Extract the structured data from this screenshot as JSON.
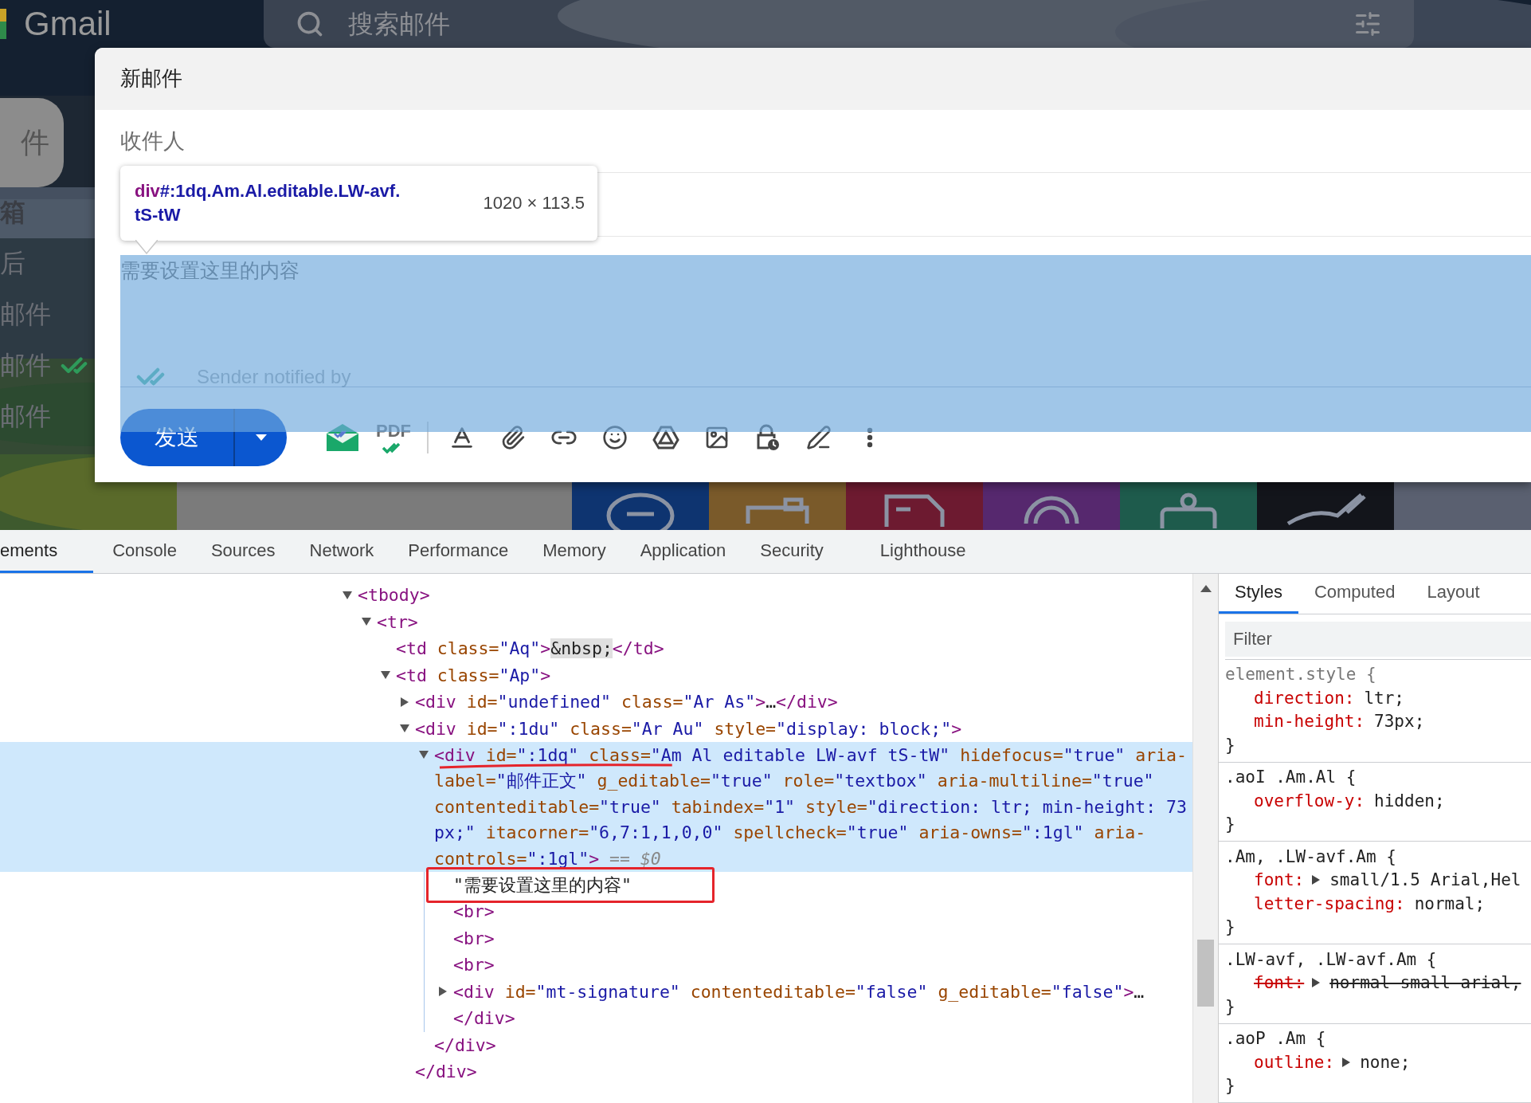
{
  "gmail": {
    "logo": "Gmail",
    "search_placeholder": "搜索邮件",
    "compose_button": "件",
    "nav": [
      {
        "label": "箱",
        "selected": true,
        "kind": "plain"
      },
      {
        "label": "后",
        "selected": false,
        "kind": "plain"
      },
      {
        "label": "邮件",
        "selected": false,
        "kind": "plain"
      },
      {
        "label": "邮件",
        "selected": false,
        "kind": "tracked"
      },
      {
        "label": "邮件",
        "selected": false,
        "kind": "plain"
      }
    ],
    "theme_tiles": [
      {
        "kind": "chat",
        "color": "#0e3470"
      },
      {
        "kind": "camera",
        "color": "#7a5a2a"
      },
      {
        "kind": "truck",
        "color": "#6d1a30"
      },
      {
        "kind": "ring",
        "color": "#56286e"
      },
      {
        "kind": "robot",
        "color": "#1e5b4c"
      },
      {
        "kind": "pen",
        "color": "#13151b"
      },
      {
        "kind": "blank",
        "color": "#5a6070"
      }
    ]
  },
  "compose": {
    "title": "新邮件",
    "to_label": "收件人",
    "body": "需要设置这里的内容",
    "tracking_note": "Sender notified by",
    "send": "发送",
    "pdf": "PDF"
  },
  "inspect_tooltip": {
    "tag": "div",
    "selector_lines": [
      "#:1dq.Am.Al.editable.LW-avf.",
      "tS-tW"
    ],
    "size": "1020 × 113.5"
  },
  "devtools": {
    "tabs": [
      {
        "label": "ements",
        "selected": true
      },
      {
        "label": "Console",
        "selected": false
      },
      {
        "label": "Sources",
        "selected": false
      },
      {
        "label": "Network",
        "selected": false
      },
      {
        "label": "Performance",
        "selected": false
      },
      {
        "label": "Memory",
        "selected": false
      },
      {
        "label": "Application",
        "selected": false
      },
      {
        "label": "Security",
        "selected": false
      },
      {
        "label": "Lighthouse",
        "selected": false
      }
    ],
    "tree": [
      {
        "open": [
          [
            {
              "kind": "tag",
              "text": "<tbody>"
            }
          ]
        ],
        "expanded": true,
        "selected": false,
        "children": [
          {
            "open": [
              [
                {
                  "kind": "tag",
                  "text": "<tr>"
                }
              ]
            ],
            "expanded": true,
            "selected": false,
            "children": [
              {
                "open": [
                  [
                    {
                      "kind": "tag",
                      "text": "<td"
                    },
                    {
                      "kind": "attr",
                      "text": " class="
                    },
                    {
                      "kind": "value",
                      "text": "\"Aq\""
                    },
                    {
                      "kind": "tag",
                      "text": ">"
                    },
                    {
                      "kind": "entity",
                      "text": "&nbsp;"
                    },
                    {
                      "kind": "tag",
                      "text": "</td>"
                    }
                  ]
                ],
                "selected": false
              },
              {
                "open": [
                  [
                    {
                      "kind": "tag",
                      "text": "<td"
                    },
                    {
                      "kind": "attr",
                      "text": " class="
                    },
                    {
                      "kind": "value",
                      "text": "\"Ap\""
                    },
                    {
                      "kind": "tag",
                      "text": ">"
                    }
                  ]
                ],
                "expanded": true,
                "selected": false,
                "children": [
                  {
                    "open": [
                      [
                        {
                          "kind": "tag",
                          "text": "<div"
                        },
                        {
                          "kind": "attr",
                          "text": " id="
                        },
                        {
                          "kind": "value",
                          "text": "\"undefined\""
                        },
                        {
                          "kind": "attr",
                          "text": " class="
                        },
                        {
                          "kind": "value",
                          "text": "\"Ar As\""
                        },
                        {
                          "kind": "tag",
                          "text": ">"
                        },
                        {
                          "kind": "plain",
                          "text": "…"
                        },
                        {
                          "kind": "tag",
                          "text": "</div>"
                        }
                      ]
                    ],
                    "expanded": false,
                    "selected": false
                  },
                  {
                    "open": [
                      [
                        {
                          "kind": "tag",
                          "text": "<div"
                        },
                        {
                          "kind": "attr",
                          "text": " id="
                        },
                        {
                          "kind": "value",
                          "text": "\":1du\""
                        },
                        {
                          "kind": "attr",
                          "text": " class="
                        },
                        {
                          "kind": "value",
                          "text": "\"Ar Au\""
                        },
                        {
                          "kind": "attr",
                          "text": " style="
                        },
                        {
                          "kind": "value",
                          "text": "\"display: block;\""
                        },
                        {
                          "kind": "tag",
                          "text": ">"
                        }
                      ]
                    ],
                    "expanded": true,
                    "selected": false,
                    "children": [
                      {
                        "open": [
                          [
                            {
                              "kind": "tag",
                              "text": "<div"
                            },
                            {
                              "kind": "attr",
                              "text": " id="
                            },
                            {
                              "kind": "value",
                              "text": "\":1dq\""
                            },
                            {
                              "kind": "attr",
                              "text": " class="
                            },
                            {
                              "kind": "value",
                              "text": "\"Am Al editable LW-avf tS-tW\""
                            },
                            {
                              "kind": "attr",
                              "text": " hidefocus="
                            },
                            {
                              "kind": "value",
                              "text": "\"true\""
                            },
                            {
                              "kind": "attr",
                              "text": " aria-"
                            }
                          ],
                          [
                            {
                              "kind": "attr",
                              "text": "label="
                            },
                            {
                              "kind": "value",
                              "text": "\"邮件正文\""
                            },
                            {
                              "kind": "attr",
                              "text": " g_editable="
                            },
                            {
                              "kind": "value",
                              "text": "\"true\""
                            },
                            {
                              "kind": "attr",
                              "text": " role="
                            },
                            {
                              "kind": "value",
                              "text": "\"textbox\""
                            },
                            {
                              "kind": "attr",
                              "text": " aria-multiline="
                            },
                            {
                              "kind": "value",
                              "text": "\"true\""
                            }
                          ],
                          [
                            {
                              "kind": "attr",
                              "text": "contenteditable="
                            },
                            {
                              "kind": "value",
                              "text": "\"true\""
                            },
                            {
                              "kind": "attr",
                              "text": " tabindex="
                            },
                            {
                              "kind": "value",
                              "text": "\"1\""
                            },
                            {
                              "kind": "attr",
                              "text": " style="
                            },
                            {
                              "kind": "value",
                              "text": "\"direction: ltr; min-height: 73"
                            }
                          ],
                          [
                            {
                              "kind": "value",
                              "text": "px;\""
                            },
                            {
                              "kind": "attr",
                              "text": " itacorner="
                            },
                            {
                              "kind": "value",
                              "text": "\"6,7:1,1,0,0\""
                            },
                            {
                              "kind": "attr",
                              "text": " spellcheck="
                            },
                            {
                              "kind": "value",
                              "text": "\"true\""
                            },
                            {
                              "kind": "attr",
                              "text": " aria-owns="
                            },
                            {
                              "kind": "value",
                              "text": "\":1gl\""
                            },
                            {
                              "kind": "attr",
                              "text": " aria-"
                            }
                          ],
                          [
                            {
                              "kind": "attr",
                              "text": "controls="
                            },
                            {
                              "kind": "value",
                              "text": "\":1gl\""
                            },
                            {
                              "kind": "tag",
                              "text": ">"
                            },
                            {
                              "kind": "dim",
                              "text": " == $0"
                            }
                          ]
                        ],
                        "expanded": true,
                        "selected": true,
                        "underlined": true,
                        "children": [
                          {
                            "open": [
                              [
                                {
                                  "kind": "plain",
                                  "text": "\"需要设置这里的内容\""
                                }
                              ]
                            ],
                            "selected": false,
                            "boxed": true
                          },
                          {
                            "open": [
                              [
                                {
                                  "kind": "tag",
                                  "text": "<br>"
                                }
                              ]
                            ],
                            "selected": false
                          },
                          {
                            "open": [
                              [
                                {
                                  "kind": "tag",
                                  "text": "<br>"
                                }
                              ]
                            ],
                            "selected": false
                          },
                          {
                            "open": [
                              [
                                {
                                  "kind": "tag",
                                  "text": "<br>"
                                }
                              ]
                            ],
                            "selected": false
                          },
                          {
                            "open": [
                              [
                                {
                                  "kind": "tag",
                                  "text": "<div"
                                },
                                {
                                  "kind": "attr",
                                  "text": " id="
                                },
                                {
                                  "kind": "value",
                                  "text": "\"mt-signature\""
                                },
                                {
                                  "kind": "attr",
                                  "text": " contenteditable="
                                },
                                {
                                  "kind": "value",
                                  "text": "\"false\""
                                },
                                {
                                  "kind": "attr",
                                  "text": " g_editable="
                                },
                                {
                                  "kind": "value",
                                  "text": "\"false\""
                                },
                                {
                                  "kind": "tag",
                                  "text": ">"
                                },
                                {
                                  "kind": "plain",
                                  "text": "…"
                                }
                              ],
                              [
                                {
                                  "kind": "tag",
                                  "text": "</div>"
                                }
                              ]
                            ],
                            "expanded": false,
                            "selected": false
                          }
                        ],
                        "close": [
                          {
                            "kind": "tag",
                            "text": "</div>"
                          }
                        ]
                      }
                    ],
                    "close": [
                      {
                        "kind": "tag",
                        "text": "</div>"
                      }
                    ]
                  }
                ]
              }
            ]
          }
        ]
      }
    ],
    "side_tabs": [
      {
        "label": "Styles",
        "selected": true
      },
      {
        "label": "Computed",
        "selected": false
      },
      {
        "label": "Layout",
        "selected": false
      }
    ],
    "filter_placeholder": "Filter",
    "rules": [
      {
        "selector": "element.style {",
        "declarations": [
          {
            "name": "direction:",
            "value": "ltr;",
            "expandable": false,
            "struck": false
          },
          {
            "name": "min-height:",
            "value": "73px;",
            "expandable": false,
            "struck": false
          }
        ],
        "close": "}"
      },
      {
        "selector": ".aoI .Am.Al {",
        "declarations": [
          {
            "name": "overflow-y:",
            "value": "hidden;",
            "expandable": false,
            "struck": false
          }
        ],
        "close": "}"
      },
      {
        "selector": ".Am, .LW-avf.Am {",
        "declarations": [
          {
            "name": "font:",
            "value": "small/1.5 Arial,Hel",
            "expandable": true,
            "struck": false
          },
          {
            "name": "letter-spacing:",
            "value": "normal;",
            "expandable": false,
            "struck": false
          }
        ],
        "close": "}"
      },
      {
        "selector": ".LW-avf, .LW-avf.Am {",
        "declarations": [
          {
            "name": "font:",
            "value": "normal small arial,",
            "expandable": true,
            "struck": true
          }
        ],
        "close": "}"
      },
      {
        "selector": ".aoP .Am {",
        "declarations": [
          {
            "name": "outline:",
            "value": "none;",
            "expandable": true,
            "struck": false
          }
        ],
        "close": "}"
      }
    ]
  }
}
